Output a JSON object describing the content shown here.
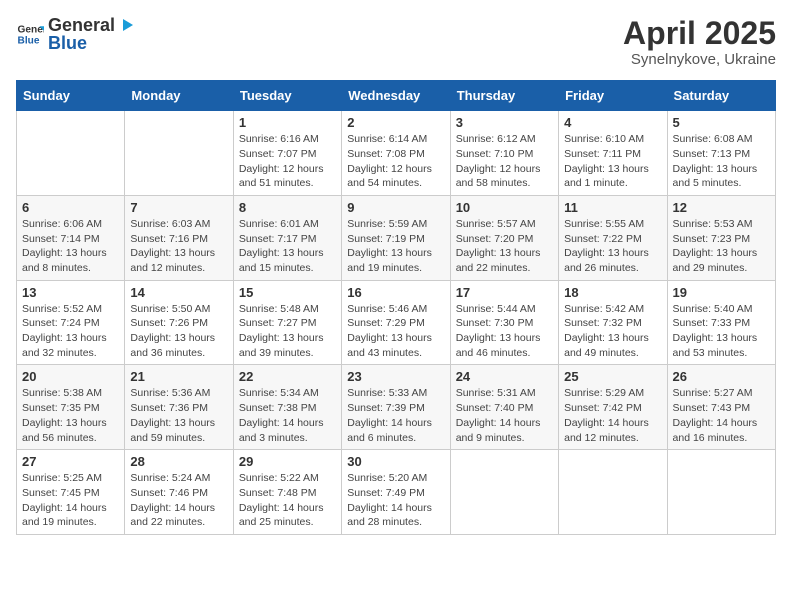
{
  "logo": {
    "general": "General",
    "blue": "Blue"
  },
  "title": {
    "month_year": "April 2025",
    "location": "Synelnykove, Ukraine"
  },
  "days_of_week": [
    "Sunday",
    "Monday",
    "Tuesday",
    "Wednesday",
    "Thursday",
    "Friday",
    "Saturday"
  ],
  "weeks": [
    [
      {
        "day": "",
        "info": ""
      },
      {
        "day": "",
        "info": ""
      },
      {
        "day": "1",
        "info": "Sunrise: 6:16 AM\nSunset: 7:07 PM\nDaylight: 12 hours and 51 minutes."
      },
      {
        "day": "2",
        "info": "Sunrise: 6:14 AM\nSunset: 7:08 PM\nDaylight: 12 hours and 54 minutes."
      },
      {
        "day": "3",
        "info": "Sunrise: 6:12 AM\nSunset: 7:10 PM\nDaylight: 12 hours and 58 minutes."
      },
      {
        "day": "4",
        "info": "Sunrise: 6:10 AM\nSunset: 7:11 PM\nDaylight: 13 hours and 1 minute."
      },
      {
        "day": "5",
        "info": "Sunrise: 6:08 AM\nSunset: 7:13 PM\nDaylight: 13 hours and 5 minutes."
      }
    ],
    [
      {
        "day": "6",
        "info": "Sunrise: 6:06 AM\nSunset: 7:14 PM\nDaylight: 13 hours and 8 minutes."
      },
      {
        "day": "7",
        "info": "Sunrise: 6:03 AM\nSunset: 7:16 PM\nDaylight: 13 hours and 12 minutes."
      },
      {
        "day": "8",
        "info": "Sunrise: 6:01 AM\nSunset: 7:17 PM\nDaylight: 13 hours and 15 minutes."
      },
      {
        "day": "9",
        "info": "Sunrise: 5:59 AM\nSunset: 7:19 PM\nDaylight: 13 hours and 19 minutes."
      },
      {
        "day": "10",
        "info": "Sunrise: 5:57 AM\nSunset: 7:20 PM\nDaylight: 13 hours and 22 minutes."
      },
      {
        "day": "11",
        "info": "Sunrise: 5:55 AM\nSunset: 7:22 PM\nDaylight: 13 hours and 26 minutes."
      },
      {
        "day": "12",
        "info": "Sunrise: 5:53 AM\nSunset: 7:23 PM\nDaylight: 13 hours and 29 minutes."
      }
    ],
    [
      {
        "day": "13",
        "info": "Sunrise: 5:52 AM\nSunset: 7:24 PM\nDaylight: 13 hours and 32 minutes."
      },
      {
        "day": "14",
        "info": "Sunrise: 5:50 AM\nSunset: 7:26 PM\nDaylight: 13 hours and 36 minutes."
      },
      {
        "day": "15",
        "info": "Sunrise: 5:48 AM\nSunset: 7:27 PM\nDaylight: 13 hours and 39 minutes."
      },
      {
        "day": "16",
        "info": "Sunrise: 5:46 AM\nSunset: 7:29 PM\nDaylight: 13 hours and 43 minutes."
      },
      {
        "day": "17",
        "info": "Sunrise: 5:44 AM\nSunset: 7:30 PM\nDaylight: 13 hours and 46 minutes."
      },
      {
        "day": "18",
        "info": "Sunrise: 5:42 AM\nSunset: 7:32 PM\nDaylight: 13 hours and 49 minutes."
      },
      {
        "day": "19",
        "info": "Sunrise: 5:40 AM\nSunset: 7:33 PM\nDaylight: 13 hours and 53 minutes."
      }
    ],
    [
      {
        "day": "20",
        "info": "Sunrise: 5:38 AM\nSunset: 7:35 PM\nDaylight: 13 hours and 56 minutes."
      },
      {
        "day": "21",
        "info": "Sunrise: 5:36 AM\nSunset: 7:36 PM\nDaylight: 13 hours and 59 minutes."
      },
      {
        "day": "22",
        "info": "Sunrise: 5:34 AM\nSunset: 7:38 PM\nDaylight: 14 hours and 3 minutes."
      },
      {
        "day": "23",
        "info": "Sunrise: 5:33 AM\nSunset: 7:39 PM\nDaylight: 14 hours and 6 minutes."
      },
      {
        "day": "24",
        "info": "Sunrise: 5:31 AM\nSunset: 7:40 PM\nDaylight: 14 hours and 9 minutes."
      },
      {
        "day": "25",
        "info": "Sunrise: 5:29 AM\nSunset: 7:42 PM\nDaylight: 14 hours and 12 minutes."
      },
      {
        "day": "26",
        "info": "Sunrise: 5:27 AM\nSunset: 7:43 PM\nDaylight: 14 hours and 16 minutes."
      }
    ],
    [
      {
        "day": "27",
        "info": "Sunrise: 5:25 AM\nSunset: 7:45 PM\nDaylight: 14 hours and 19 minutes."
      },
      {
        "day": "28",
        "info": "Sunrise: 5:24 AM\nSunset: 7:46 PM\nDaylight: 14 hours and 22 minutes."
      },
      {
        "day": "29",
        "info": "Sunrise: 5:22 AM\nSunset: 7:48 PM\nDaylight: 14 hours and 25 minutes."
      },
      {
        "day": "30",
        "info": "Sunrise: 5:20 AM\nSunset: 7:49 PM\nDaylight: 14 hours and 28 minutes."
      },
      {
        "day": "",
        "info": ""
      },
      {
        "day": "",
        "info": ""
      },
      {
        "day": "",
        "info": ""
      }
    ]
  ]
}
